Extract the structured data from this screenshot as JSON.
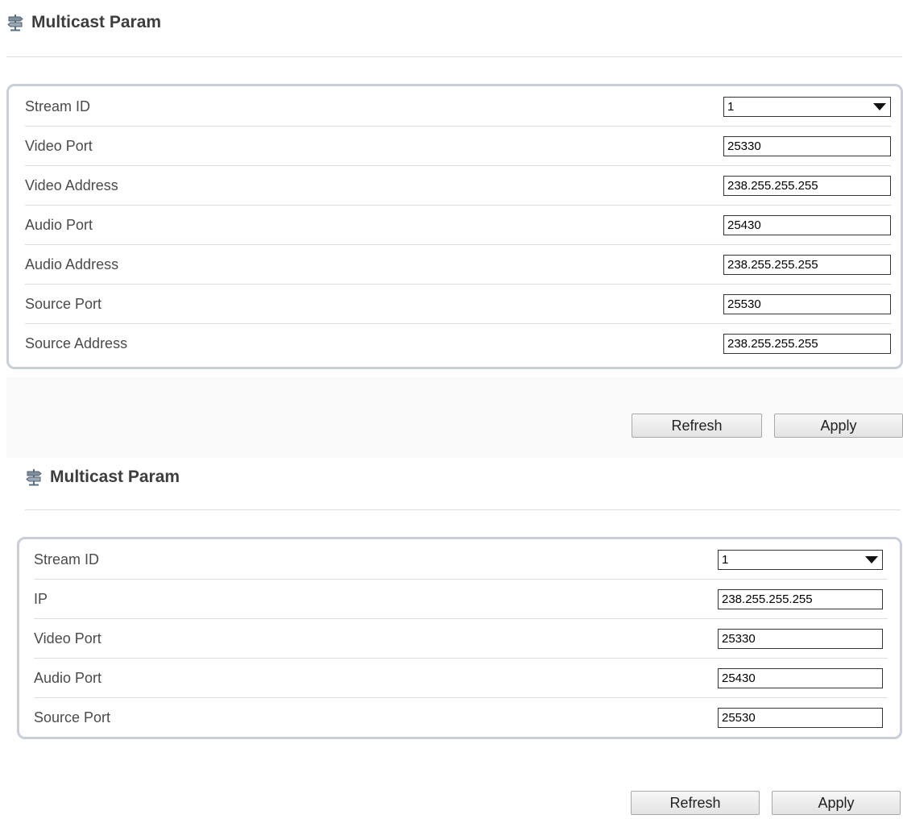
{
  "panels": [
    {
      "title": "Multicast Param",
      "fields": [
        {
          "label": "Stream ID",
          "type": "select",
          "value": "1"
        },
        {
          "label": "Video Port",
          "type": "text",
          "value": "25330"
        },
        {
          "label": "Video Address",
          "type": "text",
          "value": "238.255.255.255"
        },
        {
          "label": "Audio Port",
          "type": "text",
          "value": "25430"
        },
        {
          "label": "Audio Address",
          "type": "text",
          "value": "238.255.255.255"
        },
        {
          "label": "Source Port",
          "type": "text",
          "value": "25530"
        },
        {
          "label": "Source Address",
          "type": "text",
          "value": "238.255.255.255"
        }
      ],
      "buttons": {
        "refresh": "Refresh",
        "apply": "Apply"
      }
    },
    {
      "title": "Multicast Param",
      "fields": [
        {
          "label": "Stream ID",
          "type": "select",
          "value": "1"
        },
        {
          "label": "IP",
          "type": "text",
          "value": "238.255.255.255"
        },
        {
          "label": "Video Port",
          "type": "text",
          "value": "25330"
        },
        {
          "label": "Audio Port",
          "type": "text",
          "value": "25430"
        },
        {
          "label": "Source Port",
          "type": "text",
          "value": "25530"
        }
      ],
      "buttons": {
        "refresh": "Refresh",
        "apply": "Apply"
      }
    }
  ],
  "icon": "signpost-icon",
  "colors": {
    "border": "#c9cfd8",
    "divider": "#dedede",
    "text": "#4b4b4b",
    "title": "#3d3d3d"
  }
}
